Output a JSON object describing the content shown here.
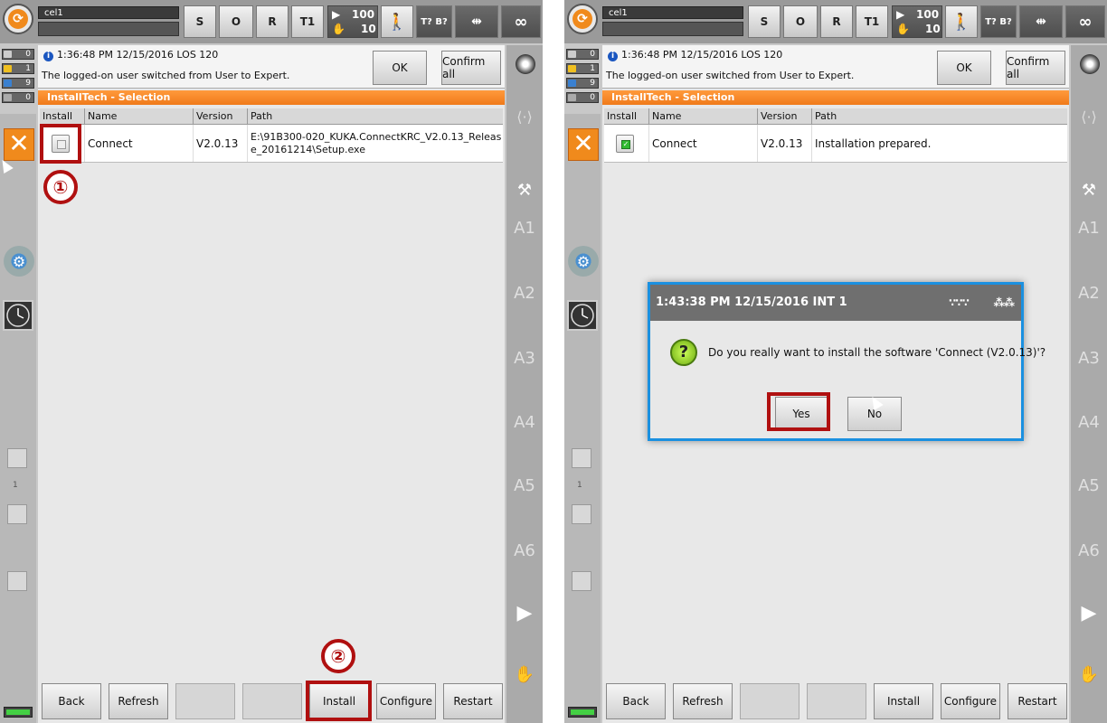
{
  "panels": [
    {
      "header": {
        "cell": "cel1",
        "status_buttons": [
          "S",
          "O",
          "R",
          "T1"
        ],
        "override": {
          "prog": "100",
          "jog": "10"
        },
        "tool_base": "T? B?",
        "infinity": "∞"
      },
      "counts": {
        "ack": "0",
        "warn": "1",
        "info": "9",
        "wait": "0"
      },
      "message": {
        "time": "1:36:48 PM 12/15/2016 LOS 120",
        "text": "The logged-on user switched from User to Expert.",
        "ok": "OK",
        "confirm_all": "Confirm all"
      },
      "title": "InstallTech - Selection",
      "columns": [
        "Install",
        "Name",
        "Version",
        "Path"
      ],
      "row": {
        "checked": false,
        "name": "Connect",
        "version": "V2.0.13",
        "path": "E:\\91B300-020_KUKA.ConnectKRC_V2.0.13_Release_20161214\\Setup.exe"
      },
      "left_num": "1",
      "axes": [
        "A1",
        "A2",
        "A3",
        "A4",
        "A5",
        "A6"
      ],
      "footer": [
        "Back",
        "Refresh",
        "",
        "",
        "Install",
        "Configure",
        "Restart"
      ],
      "callouts": [
        "①",
        "②"
      ]
    },
    {
      "header": {
        "cell": "cel1",
        "status_buttons": [
          "S",
          "O",
          "R",
          "T1"
        ],
        "override": {
          "prog": "100",
          "jog": "10"
        },
        "tool_base": "T? B?",
        "infinity": "∞"
      },
      "counts": {
        "ack": "0",
        "warn": "1",
        "info": "9",
        "wait": "0"
      },
      "message": {
        "time": "1:36:48 PM 12/15/2016 LOS 120",
        "text": "The logged-on user switched from User to Expert.",
        "ok": "OK",
        "confirm_all": "Confirm all"
      },
      "title": "InstallTech - Selection",
      "columns": [
        "Install",
        "Name",
        "Version",
        "Path"
      ],
      "row": {
        "checked": true,
        "name": "Connect",
        "version": "V2.0.13",
        "path": "Installation prepared."
      },
      "left_num": "1",
      "axes": [
        "A1",
        "A2",
        "A3",
        "A4",
        "A5",
        "A6"
      ],
      "footer": [
        "Back",
        "Refresh",
        "",
        "",
        "Install",
        "Configure",
        "Restart"
      ],
      "dialog": {
        "time": "1:43:38 PM 12/15/2016 INT 1",
        "question": "Do you really want to install the software 'Connect (V2.0.13)'?",
        "yes": "Yes",
        "no": "No"
      }
    }
  ],
  "colors": {
    "accent": "#f08a1c",
    "highlight": "#b01010",
    "dialog_border": "#1a90e0"
  }
}
